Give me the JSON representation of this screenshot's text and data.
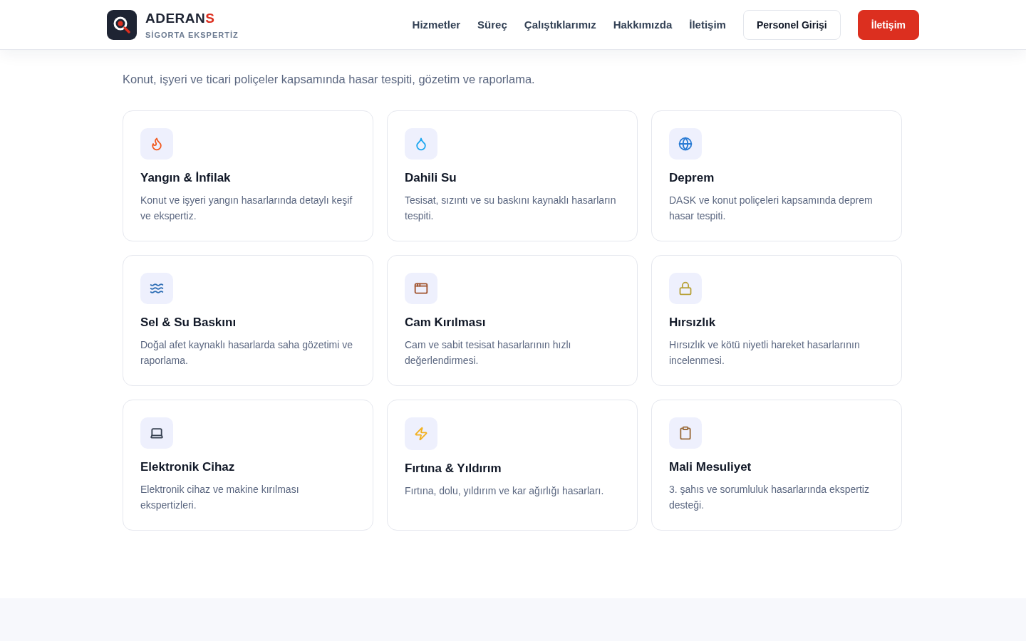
{
  "header": {
    "brand": {
      "name": "ADERAN",
      "name_accent": "S",
      "tagline": "SİGORTA EKSPERTİZ"
    },
    "nav": [
      "Hizmetler",
      "Süreç",
      "Çalıştıklarımız",
      "Hakkımızda",
      "İletişim"
    ],
    "buttons": [
      {
        "label": "Personel Girişi",
        "kind": "outline"
      },
      {
        "label": "İletişim",
        "kind": "primary"
      }
    ]
  },
  "section": {
    "subtitle": "Konut, işyeri ve ticari poliçeler kapsamında hasar tespiti, gözetim ve raporlama.",
    "cards": [
      {
        "title": "Yangın & İnfilak",
        "text": "Konut ve işyeri yangın hasarlarında detaylı keşif ve ekspertiz."
      },
      {
        "title": "Dahili Su",
        "text": "Tesisat, sızıntı ve su baskını kaynaklı hasarların tespiti."
      },
      {
        "title": "Deprem",
        "text": "DASK ve konut poliçeleri kapsamında deprem hasar tespiti."
      },
      {
        "title": "Sel & Su Baskını",
        "text": "Doğal afet kaynaklı hasarlarda saha gözetimi ve raporlama."
      },
      {
        "title": "Cam Kırılması",
        "text": "Cam ve sabit tesisat hasarlarının hızlı değerlendirmesi."
      },
      {
        "title": "Hırsızlık",
        "text": "Hırsızlık ve kötü niyetli hareket hasarlarının incelenmesi."
      },
      {
        "title": "Elektronik Cihaz",
        "text": "Elektronik cihaz ve makine kırılması ekspertizleri."
      },
      {
        "title": "Fırtına & Yıldırım",
        "text": "Fırtına, dolu, yıldırım ve kar ağırlığı hasarları."
      },
      {
        "title": "Mali Mesuliyet",
        "text": "3. şahıs ve sorumluluk hasarlarında ekspertiz desteği."
      }
    ]
  }
}
